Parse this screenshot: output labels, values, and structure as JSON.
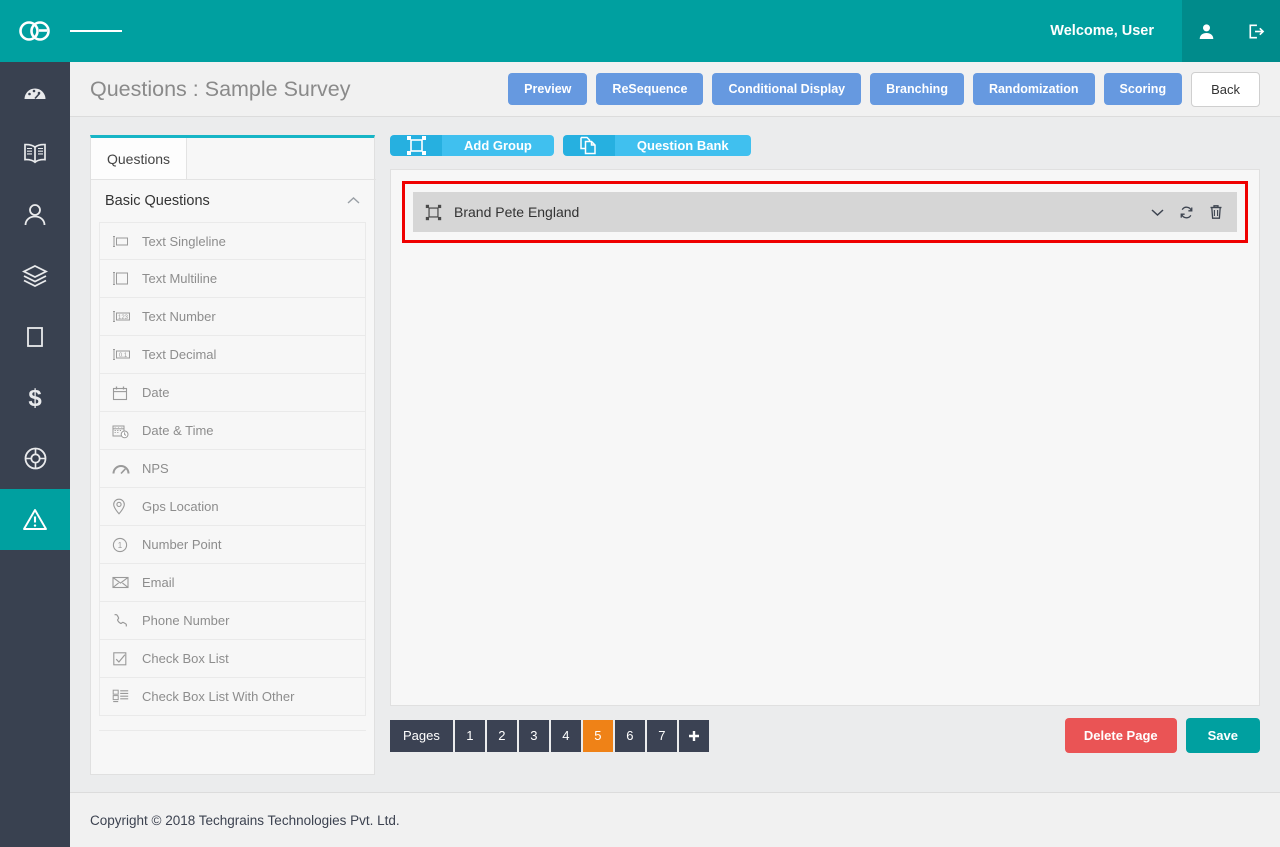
{
  "header": {
    "logo_alt": "go-logo",
    "menu_toggle": "hamburger-menu",
    "welcome_text": "Welcome, User",
    "user_icon": "user-icon",
    "logout_icon": "logout-icon",
    "bg_color": "#00a0a0",
    "bg_color_dark": "#008b8b"
  },
  "sidebar": {
    "bg_color": "#394150",
    "active_color": "#00a0a0",
    "items": [
      {
        "name": "dashboard",
        "icon": "speedometer-icon",
        "active": false
      },
      {
        "name": "library",
        "icon": "book-icon",
        "active": false
      },
      {
        "name": "users",
        "icon": "user-icon",
        "active": false
      },
      {
        "name": "layers",
        "icon": "layers-icon",
        "active": false
      },
      {
        "name": "forms",
        "icon": "square-icon",
        "active": false
      },
      {
        "name": "billing",
        "icon": "dollar-icon",
        "active": false
      },
      {
        "name": "support",
        "icon": "lifebuoy-icon",
        "active": false
      },
      {
        "name": "surveys",
        "icon": "warning-triangle-icon",
        "active": true
      }
    ]
  },
  "titlebar": {
    "title": "Questions : Sample Survey",
    "buttons": [
      {
        "label": "Preview",
        "style": "blue"
      },
      {
        "label": "ReSequence",
        "style": "blue"
      },
      {
        "label": "Conditional Display",
        "style": "blue"
      },
      {
        "label": "Branching",
        "style": "blue"
      },
      {
        "label": "Randomization",
        "style": "blue"
      },
      {
        "label": "Scoring",
        "style": "blue"
      }
    ],
    "back_label": "Back",
    "blue_color": "#6699e0"
  },
  "left_panel": {
    "tab_label": "Questions",
    "accent_color": "#17b5c6",
    "group_label": "Basic Questions",
    "collapse_icon": "chevron-up-icon",
    "items": [
      {
        "label": "Text Singleline",
        "icon": "text-singleline-icon"
      },
      {
        "label": "Text Multiline",
        "icon": "text-multiline-icon"
      },
      {
        "label": "Text Number",
        "icon": "text-number-icon"
      },
      {
        "label": "Text Decimal",
        "icon": "text-decimal-icon"
      },
      {
        "label": "Date",
        "icon": "calendar-icon"
      },
      {
        "label": "Date & Time",
        "icon": "calendar-clock-icon"
      },
      {
        "label": "NPS",
        "icon": "gauge-icon"
      },
      {
        "label": "Gps Location",
        "icon": "map-pin-icon"
      },
      {
        "label": "Number Point",
        "icon": "number-circle-icon"
      },
      {
        "label": "Email",
        "icon": "envelope-icon"
      },
      {
        "label": "Phone Number",
        "icon": "phone-icon"
      },
      {
        "label": "Check Box List",
        "icon": "checkbox-icon"
      },
      {
        "label": "Check Box List With Other",
        "icon": "checkbox-list-other-icon"
      }
    ]
  },
  "main": {
    "toolbar": [
      {
        "label": "Add Group",
        "icon": "group-frame-icon"
      },
      {
        "label": "Question Bank",
        "icon": "copy-pages-icon"
      }
    ],
    "highlight_color": "#ef0000",
    "group": {
      "icon": "group-frame-icon",
      "title": "Brand Pete England",
      "actions": [
        {
          "name": "expand",
          "icon": "chevron-down-icon"
        },
        {
          "name": "refresh",
          "icon": "refresh-icon"
        },
        {
          "name": "delete",
          "icon": "trash-icon"
        }
      ]
    },
    "footer": {
      "pages_label": "Pages",
      "pages": [
        "1",
        "2",
        "3",
        "4",
        "5",
        "6",
        "7"
      ],
      "active_page": "5",
      "add_page_icon": "plus-icon",
      "delete_page_label": "Delete Page",
      "save_label": "Save",
      "active_page_color": "#ef8217",
      "delete_color": "#ea5455",
      "save_color": "#00a0a0"
    }
  },
  "footer": {
    "copyright": "Copyright © 2018 Techgrains Technologies Pvt. Ltd."
  }
}
